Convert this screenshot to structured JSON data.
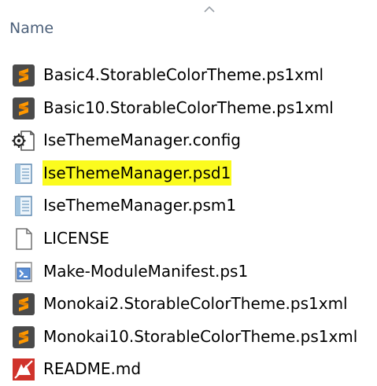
{
  "column_header": {
    "label": "Name",
    "sort_indicator": "chevron-up-icon"
  },
  "highlight_color": "#fbfb1e",
  "files": [
    {
      "name": "Basic4.StorableColorTheme.ps1xml",
      "icon": "sublime-text-icon",
      "highlighted": false
    },
    {
      "name": "Basic10.StorableColorTheme.ps1xml",
      "icon": "sublime-text-icon",
      "highlighted": false
    },
    {
      "name": "IseThemeManager.config",
      "icon": "config-file-icon",
      "highlighted": false
    },
    {
      "name": "IseThemeManager.psd1",
      "icon": "text-document-icon",
      "highlighted": true
    },
    {
      "name": "IseThemeManager.psm1",
      "icon": "text-document-icon",
      "highlighted": false
    },
    {
      "name": "LICENSE",
      "icon": "blank-file-icon",
      "highlighted": false
    },
    {
      "name": "Make-ModuleManifest.ps1",
      "icon": "script-file-icon",
      "highlighted": false
    },
    {
      "name": "Monokai2.StorableColorTheme.ps1xml",
      "icon": "sublime-text-icon",
      "highlighted": false
    },
    {
      "name": "Monokai10.StorableColorTheme.ps1xml",
      "icon": "sublime-text-icon",
      "highlighted": false
    },
    {
      "name": "README.md",
      "icon": "markdown-editor-icon",
      "highlighted": false
    }
  ]
}
